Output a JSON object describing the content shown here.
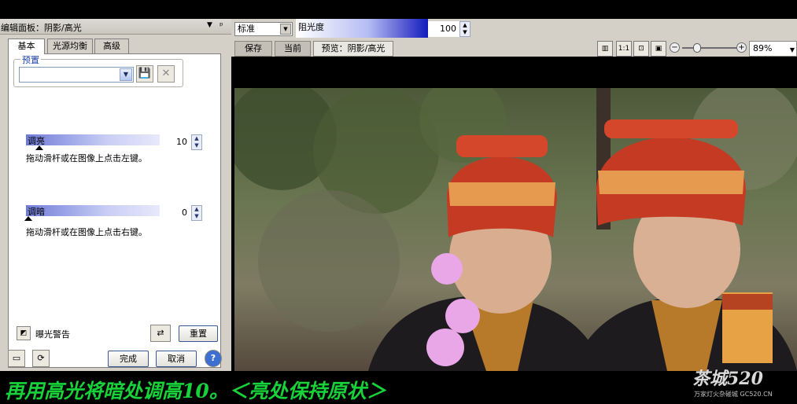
{
  "panel": {
    "title": "编辑面板：阴影/高光",
    "menu_arrow": "▼",
    "pin": "ᵖ",
    "tabs": [
      "基本",
      "光源均衡",
      "高级"
    ],
    "preset_legend": "预置",
    "preset_value": "",
    "lighten": {
      "label": "调亮",
      "value": "10",
      "hint": "拖动滑杆或在图像上点击左键。",
      "level_fraction": 0.1
    },
    "darken": {
      "label": "调暗",
      "value": "0",
      "hint": "拖动滑杆或在图像上点击右键。",
      "level_fraction": 0.0
    },
    "exposure_warning": "曝光警告",
    "reset_button": "重置",
    "ok_button": "完成",
    "cancel_button": "取消",
    "help_button": "?"
  },
  "toolbar": {
    "blend_mode": "标准",
    "opacity_label": "阻光度",
    "opacity_value": "100",
    "view_tabs": [
      "保存",
      "当前",
      "预览：阴影/高光"
    ],
    "zoom_value": "89%"
  },
  "caption": {
    "text": "再用高光将暗处调高10。＜亮处保持原状＞"
  },
  "watermark": {
    "main": "茶城520",
    "sub": "万家灯火杂碰城 GC520.CN"
  },
  "colors": {
    "caption_green": "#18d23a",
    "panel_gray": "#d4d0c8",
    "opacity_blue": "#141bbd"
  }
}
